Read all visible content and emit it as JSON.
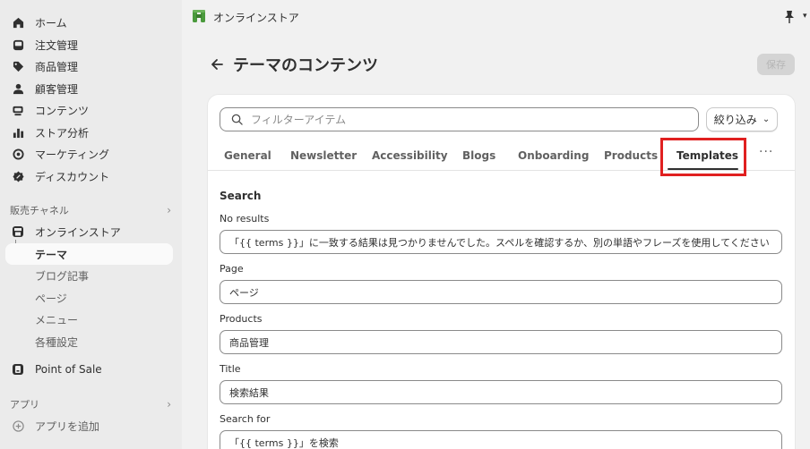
{
  "sidebar": {
    "items": [
      {
        "label": "ホーム",
        "icon": "home-icon"
      },
      {
        "label": "注文管理",
        "icon": "inbox-icon"
      },
      {
        "label": "商品管理",
        "icon": "tag-icon"
      },
      {
        "label": "顧客管理",
        "icon": "person-icon"
      },
      {
        "label": "コンテンツ",
        "icon": "content-icon"
      },
      {
        "label": "ストア分析",
        "icon": "bar-chart-icon"
      },
      {
        "label": "マーケティング",
        "icon": "target-icon"
      },
      {
        "label": "ディスカウント",
        "icon": "discount-icon"
      }
    ],
    "sales_channels_label": "販売チャネル",
    "online_store_label": "オンラインストア",
    "theme_label": "テーマ",
    "blog_label": "ブログ記事",
    "pages_label": "ページ",
    "menu_label": "メニュー",
    "settings_label": "各種設定",
    "pos_label": "Point of Sale",
    "apps_label": "アプリ",
    "add_app_label": "アプリを追加"
  },
  "topbar": {
    "store_name": "オンラインストア"
  },
  "header": {
    "title": "テーマのコンテンツ",
    "save_label": "保存"
  },
  "filter": {
    "placeholder": "フィルターアイテム",
    "button_label": "絞り込み"
  },
  "tabs": [
    {
      "label": "General"
    },
    {
      "label": "Newsletter"
    },
    {
      "label": "Accessibility"
    },
    {
      "label": "Blogs"
    },
    {
      "label": "Onboarding"
    },
    {
      "label": "Products"
    },
    {
      "label": "Templates"
    }
  ],
  "more_tabs_label": "···",
  "section": {
    "title": "Search",
    "fields": [
      {
        "label": "No results",
        "value": "「{{ terms }}」に一致する結果は見つかりませんでした。スペルを確認するか、別の単語やフレーズを使用してください"
      },
      {
        "label": "Page",
        "value": "ページ"
      },
      {
        "label": "Products",
        "value": "商品管理"
      },
      {
        "label": "Title",
        "value": "検索結果"
      },
      {
        "label": "Search for",
        "value": "「{{ terms }}」を検索"
      }
    ]
  },
  "colors": {
    "highlight": "#e02020",
    "sidebar_bg": "#ebebeb",
    "page_bg": "#f1f1f1",
    "store_logo": "#4a9a3c"
  }
}
